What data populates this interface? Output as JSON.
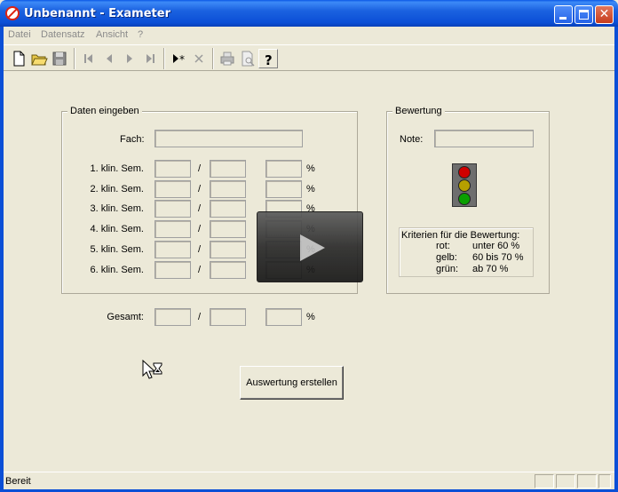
{
  "window": {
    "title": "Unbenannt - Exameter",
    "controls": [
      "minimize-icon",
      "maximize-icon",
      "close-icon"
    ]
  },
  "menu": {
    "items": [
      "Datei",
      "Datensatz",
      "Ansicht",
      "?"
    ],
    "color": "#8a8a8a"
  },
  "toolbar": {
    "icons": [
      "new-document-icon",
      "open-folder-icon",
      "save-icon",
      "first-record-icon",
      "previous-record-icon",
      "next-record-icon",
      "last-record-icon",
      "new-record-icon",
      "delete-record-icon",
      "print-icon",
      "print-preview-icon",
      "help-icon"
    ]
  },
  "daten": {
    "group_label": "Daten eingeben",
    "fach_label": "Fach:",
    "fach_value": "",
    "rows": [
      {
        "label": "1. klin. Sem.",
        "a": "",
        "b": "",
        "percent": ""
      },
      {
        "label": "2. klin. Sem.",
        "a": "",
        "b": "",
        "percent": ""
      },
      {
        "label": "3. klin. Sem.",
        "a": "",
        "b": "",
        "percent": ""
      },
      {
        "label": "4. klin. Sem.",
        "a": "",
        "b": "",
        "percent": ""
      },
      {
        "label": "5. klin. Sem.",
        "a": "",
        "b": "",
        "percent": ""
      },
      {
        "label": "6. klin. Sem.",
        "a": "",
        "b": "",
        "percent": ""
      }
    ],
    "slash": "/",
    "percent_sign": "%",
    "gesamt_label": "Gesamt:"
  },
  "bewertung": {
    "group_label": "Bewertung",
    "note_label": "Note:",
    "note_value": "",
    "traffic_light_colors": [
      "#d00000",
      "#b6a000",
      "#0aa000"
    ],
    "criteria_title": "Kriterien für die Bewertung:",
    "criteria": [
      {
        "color": "rot:",
        "range": "unter 60 %"
      },
      {
        "color": "gelb:",
        "range": "60 bis 70 %"
      },
      {
        "color": "grün:",
        "range": "ab 70 %"
      }
    ]
  },
  "actions": {
    "auswertung_label": "Auswertung erstellen"
  },
  "overlay": {
    "icon": "play-icon"
  },
  "status": {
    "text": "Bereit"
  }
}
